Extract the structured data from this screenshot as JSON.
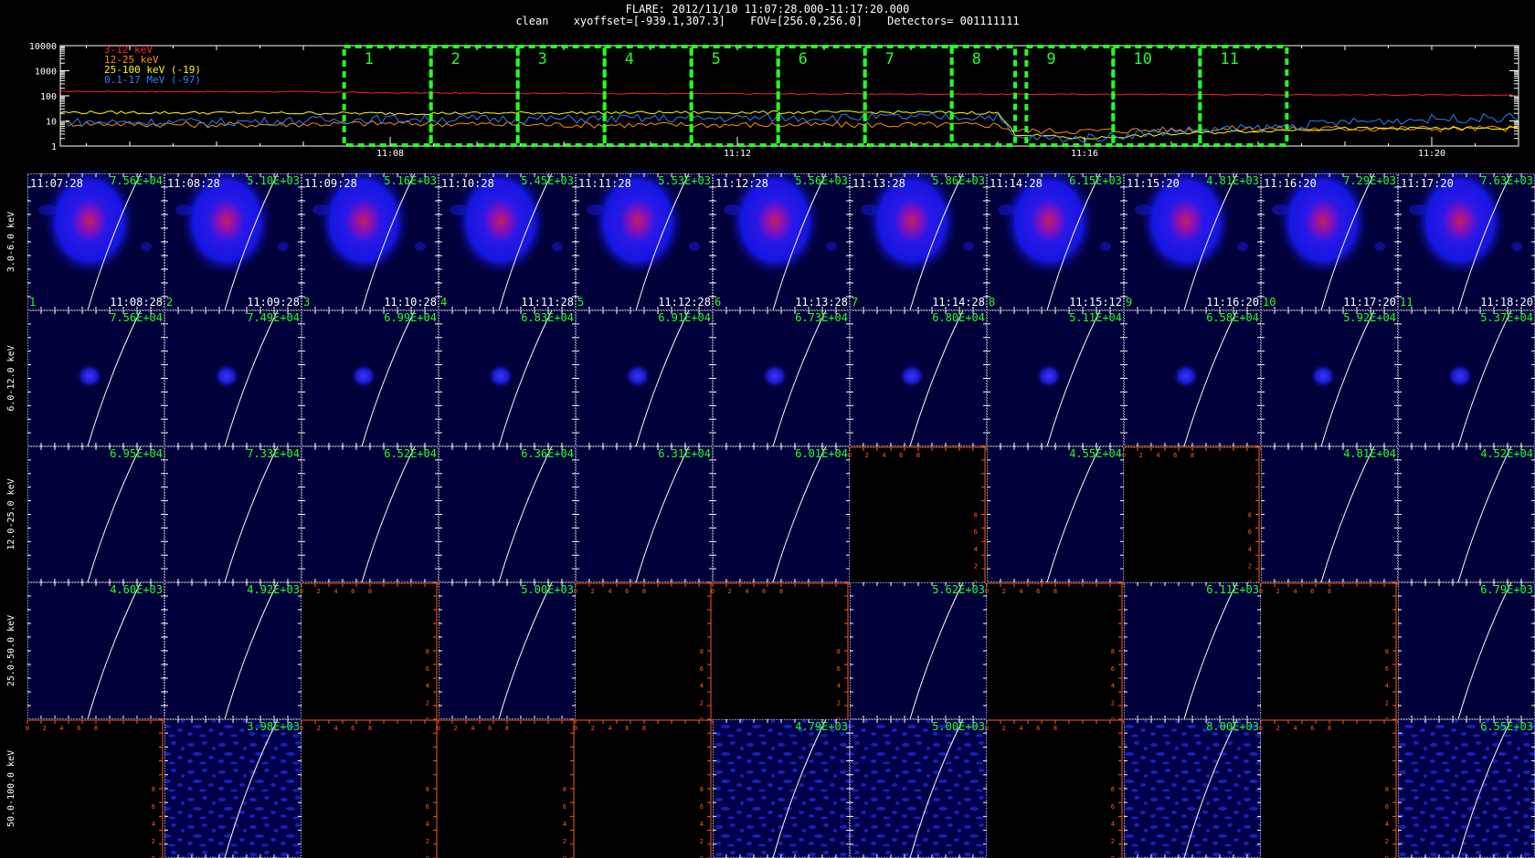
{
  "header": {
    "line1": "FLARE: 2012/11/10 11:07:28.000-11:17:20.000",
    "line2_mode": "clean",
    "line2_xyoffset": "xyoffset=[-939.1,307.3]",
    "line2_fov": "FOV=[256.0,256.0]",
    "line2_detectors": "Detectors= 001111111"
  },
  "colors": {
    "band_3_12": "#ff2020",
    "band_12_25": "#ff8c00",
    "band_25_100": "#ffff00",
    "band_100_17000": "#2a7fff",
    "interval_box": "#22ff22",
    "panel_bg": "#00003a",
    "empty_axis": "#ff5a1a"
  },
  "chart_data": [
    {
      "type": "line",
      "title": "",
      "xlabel": "",
      "ylabel": "",
      "y_scale": "log",
      "ylim": [
        1,
        10000
      ],
      "y_tick_labels": [
        "10000",
        "1000",
        "100",
        "10",
        "1"
      ],
      "x_tick_labels": [
        "11:08",
        "11:12",
        "11:16",
        "11:20"
      ],
      "x_ticks_minutes": [
        8,
        12,
        16,
        20
      ],
      "xlim_minutes": [
        4.2,
        21.0
      ],
      "legend_position": "top-left",
      "series": [
        {
          "name": "3-12 keV",
          "color": "#ff2020",
          "x": [
            4.2,
            7.0,
            8.0,
            12.0,
            16.0,
            19.0,
            21.0
          ],
          "values": [
            150,
            145,
            130,
            120,
            115,
            110,
            105
          ]
        },
        {
          "name": "12-25 keV",
          "color": "#ff8c00",
          "x": [
            4.2,
            6.0,
            8.0,
            10.0,
            12.0,
            14.0,
            15.0,
            15.2,
            16.0,
            18.0,
            19.0,
            21.0
          ],
          "values": [
            8,
            7,
            8,
            7,
            7,
            7,
            7,
            4,
            4,
            5,
            5,
            5
          ]
        },
        {
          "name": "25-100 keV (-19)",
          "color": "#ffff00",
          "x": [
            4.2,
            6.0,
            8.0,
            10.0,
            12.0,
            14.0,
            15.0,
            15.2,
            16.0,
            17.0,
            18.0,
            19.0,
            21.0
          ],
          "values": [
            22,
            21,
            20,
            21,
            22,
            22,
            21,
            3,
            2,
            3,
            4,
            5,
            5
          ]
        },
        {
          "name": "0.1-17 MeV (-97)",
          "color": "#2a7fff",
          "x": [
            4.2,
            6.0,
            8.0,
            10.0,
            12.0,
            14.0,
            15.0,
            15.2,
            16.0,
            17.0,
            18.0,
            19.0,
            20.0,
            21.0
          ],
          "values": [
            9,
            9,
            12,
            12,
            13,
            14,
            15,
            2,
            2,
            4,
            5,
            9,
            12,
            14
          ]
        }
      ],
      "intervals": [
        {
          "label": "1",
          "start": "11:07:28",
          "end": "11:08:28"
        },
        {
          "label": "2",
          "start": "11:08:28",
          "end": "11:09:28"
        },
        {
          "label": "3",
          "start": "11:09:28",
          "end": "11:10:28"
        },
        {
          "label": "4",
          "start": "11:10:28",
          "end": "11:11:28"
        },
        {
          "label": "5",
          "start": "11:11:28",
          "end": "11:12:28"
        },
        {
          "label": "6",
          "start": "11:12:28",
          "end": "11:13:28"
        },
        {
          "label": "7",
          "start": "11:13:28",
          "end": "11:14:28"
        },
        {
          "label": "8",
          "start": "11:14:28",
          "end": "11:15:12"
        },
        {
          "label": "9",
          "start": "11:15:20",
          "end": "11:16:20"
        },
        {
          "label": "10",
          "start": "11:16:20",
          "end": "11:17:20"
        },
        {
          "label": "11",
          "start": "11:17:20",
          "end": "11:18:20"
        }
      ],
      "interval_minutes": [
        [
          7.47,
          8.47
        ],
        [
          8.47,
          9.47
        ],
        [
          9.47,
          10.47
        ],
        [
          10.47,
          11.47
        ],
        [
          11.47,
          12.47
        ],
        [
          12.47,
          13.47
        ],
        [
          13.47,
          14.47
        ],
        [
          14.47,
          15.2
        ],
        [
          15.33,
          16.33
        ],
        [
          16.33,
          17.33
        ],
        [
          17.33,
          18.33
        ]
      ]
    },
    {
      "type": "heatmap",
      "row_labels": [
        "3.0-6.0 keV",
        "6.0-12.0 keV",
        "12.0-25.0 keV",
        "25.0-50.0 keV",
        "50.0-100.0 keV"
      ],
      "column_start_times": [
        "11:07:28",
        "11:08:28",
        "11:09:28",
        "11:10:28",
        "11:11:28",
        "11:12:28",
        "11:13:28",
        "11:14:28",
        "11:15:20",
        "11:16:20",
        "11:17:20"
      ],
      "column_end_times": [
        "11:08:28",
        "11:09:28",
        "11:10:28",
        "11:11:28",
        "11:12:28",
        "11:13:28",
        "11:14:28",
        "11:15:12",
        "11:16:20",
        "11:17:20",
        "11:18:20"
      ],
      "column_numbers": [
        "1",
        "2",
        "3",
        "4",
        "5",
        "6",
        "7",
        "8",
        "9",
        "10",
        "11"
      ],
      "empty_axis_tick_labels": [
        "0",
        "2",
        "4",
        "6",
        "8"
      ],
      "peaks": [
        [
          "7.56E+04",
          "5.10E+03",
          "5.16E+03",
          "5.45E+03",
          "5.53E+03",
          "5.56E+03",
          "5.86E+03",
          "6.15E+03",
          "4.81E+03",
          "7.29E+03",
          "7.63E+03"
        ],
        [
          "7.56E+04",
          "7.49E+04",
          "6.99E+04",
          "6.83E+04",
          "6.91E+04",
          "6.73E+04",
          "6.80E+04",
          "5.11E+04",
          "6.58E+04",
          "5.92E+04",
          "5.37E+04"
        ],
        [
          "6.95E+04",
          "7.33E+04",
          "6.52E+04",
          "6.36E+04",
          "6.31E+04",
          "6.01E+04",
          null,
          "4.55E+04",
          null,
          "4.81E+04",
          "4.52E+04"
        ],
        [
          "4.60E+03",
          "4.92E+03",
          null,
          "5.00E+03",
          null,
          null,
          "5.62E+03",
          null,
          "6.11E+03",
          null,
          "6.79E+03"
        ],
        [
          null,
          "3.98E+03",
          null,
          null,
          null,
          "4.79E+03",
          "5.00E+03",
          null,
          "8.00E+03",
          null,
          "6.55E+03"
        ]
      ],
      "image_style": [
        [
          "source",
          "source",
          "source",
          "source",
          "source",
          "source",
          "source",
          "source",
          "source",
          "source",
          "source"
        ],
        [
          "compact",
          "compact",
          "compact",
          "compact",
          "compact",
          "compact",
          "compact",
          "compact",
          "compact",
          "compact",
          "compact"
        ],
        [
          "plain",
          "plain",
          "plain",
          "plain",
          "plain",
          "plain",
          null,
          "plain",
          null,
          "plain",
          "plain"
        ],
        [
          "plain",
          "plain",
          null,
          "plain",
          null,
          null,
          "plain",
          null,
          "plain",
          null,
          "plain"
        ],
        [
          null,
          "noise",
          null,
          null,
          null,
          "noise",
          "noise",
          null,
          "noise",
          null,
          "noise"
        ]
      ]
    }
  ]
}
